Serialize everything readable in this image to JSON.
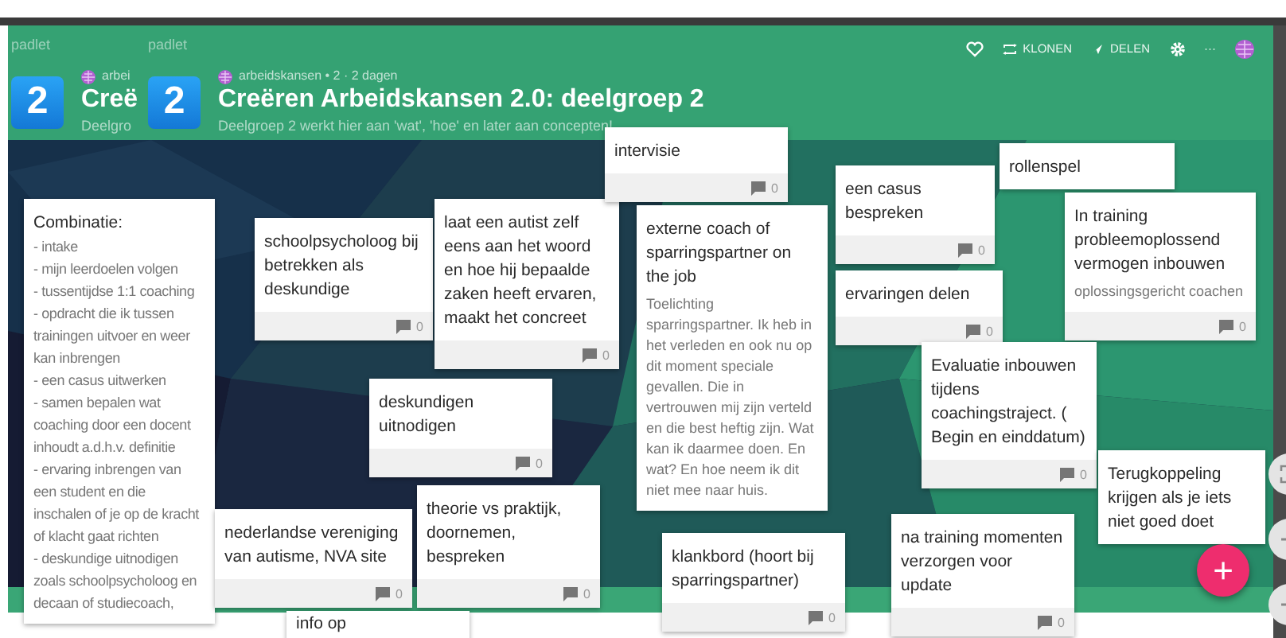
{
  "boards": [
    {
      "brand": "padlet",
      "badge": "2",
      "meta": "arbei",
      "title": "Creë",
      "subtitle": "Deelgro"
    },
    {
      "brand": "padlet",
      "badge": "2",
      "meta": "arbeidskansen • 2 · 2 dagen",
      "title": "Creëren Arbeidskansen 2.0: deelgroep 2",
      "subtitle": "Deelgroep 2 werkt hier aan 'wat', 'hoe' en later aan concepten!"
    }
  ],
  "actions": [
    {
      "kind": "like"
    },
    {
      "kind": "clone",
      "label": "KLONEN"
    },
    {
      "kind": "share",
      "label": "DELEN"
    },
    {
      "kind": "settings"
    },
    {
      "kind": "more",
      "label": "···"
    },
    {
      "kind": "avatar"
    }
  ],
  "cards": [
    {
      "title": "Combinatie:",
      "lines": [
        "- intake",
        "- mijn leerdoelen volgen",
        "- tussentijdse 1:1 coaching",
        "- opdracht die ik tussen trainingen uitvoer en weer kan inbrengen",
        "- een casus uitwerken",
        "- samen bepalen wat coaching door een docent inhoudt a.d.h.v. definitie",
        "- ervaring inbrengen van een student en die inschalen of je op de kracht of klacht gaat richten",
        "- deskundige uitnodigen zoals schoolpsycholoog en decaan of studiecoach,"
      ]
    },
    {
      "title": "schoolpsycholoog bij betrekken als deskundige",
      "comments": "0"
    },
    {
      "title": "laat een autist zelf eens aan het woord en hoe hij bepaalde zaken heeft ervaren, maakt het concreet",
      "comments": "0"
    },
    {
      "title": "deskundigen uitnodigen",
      "comments": "0"
    },
    {
      "title": "nederlandse vereniging van autisme, NVA site",
      "comments": "0"
    },
    {
      "title": "theorie vs praktijk, doornemen, bespreken",
      "comments": "0"
    },
    {
      "title": "info op"
    },
    {
      "title": "intervisie",
      "comments": "0"
    },
    {
      "title": "externe coach of sparringspartner on the job",
      "lines": [
        "Toelichting sparringspartner. Ik heb in het verleden en ook nu op dit moment speciale gevallen. Die in vertrouwen mij zijn verteld en die best heftig zijn. Wat kan ik daarmee doen. En wat? En hoe neem ik dit niet mee naar huis."
      ]
    },
    {
      "title": "een casus bespreken",
      "comments": "0"
    },
    {
      "title": "ervaringen delen",
      "comments": "0"
    },
    {
      "title": "rollenspel"
    },
    {
      "title": "In training probleemoplossend vermogen inbouwen",
      "lines": [
        "oplossingsgericht coachen"
      ],
      "comments": "0"
    },
    {
      "title": "Evaluatie inbouwen tijdens coachingstraject. ( Begin en einddatum)",
      "comments": "0"
    },
    {
      "title": "na training momenten verzorgen voor update",
      "comments": "0"
    },
    {
      "title": "Terugkoppeling krijgen als je iets niet goed doet"
    },
    {
      "title": "klankbord (hoort bij sparringspartner)",
      "comments": "0"
    }
  ],
  "fab": {
    "label": "+"
  },
  "zoom_controls": [
    {
      "kind": "fit"
    },
    {
      "kind": "zoom_in"
    },
    {
      "kind": "zoom_out"
    }
  ]
}
